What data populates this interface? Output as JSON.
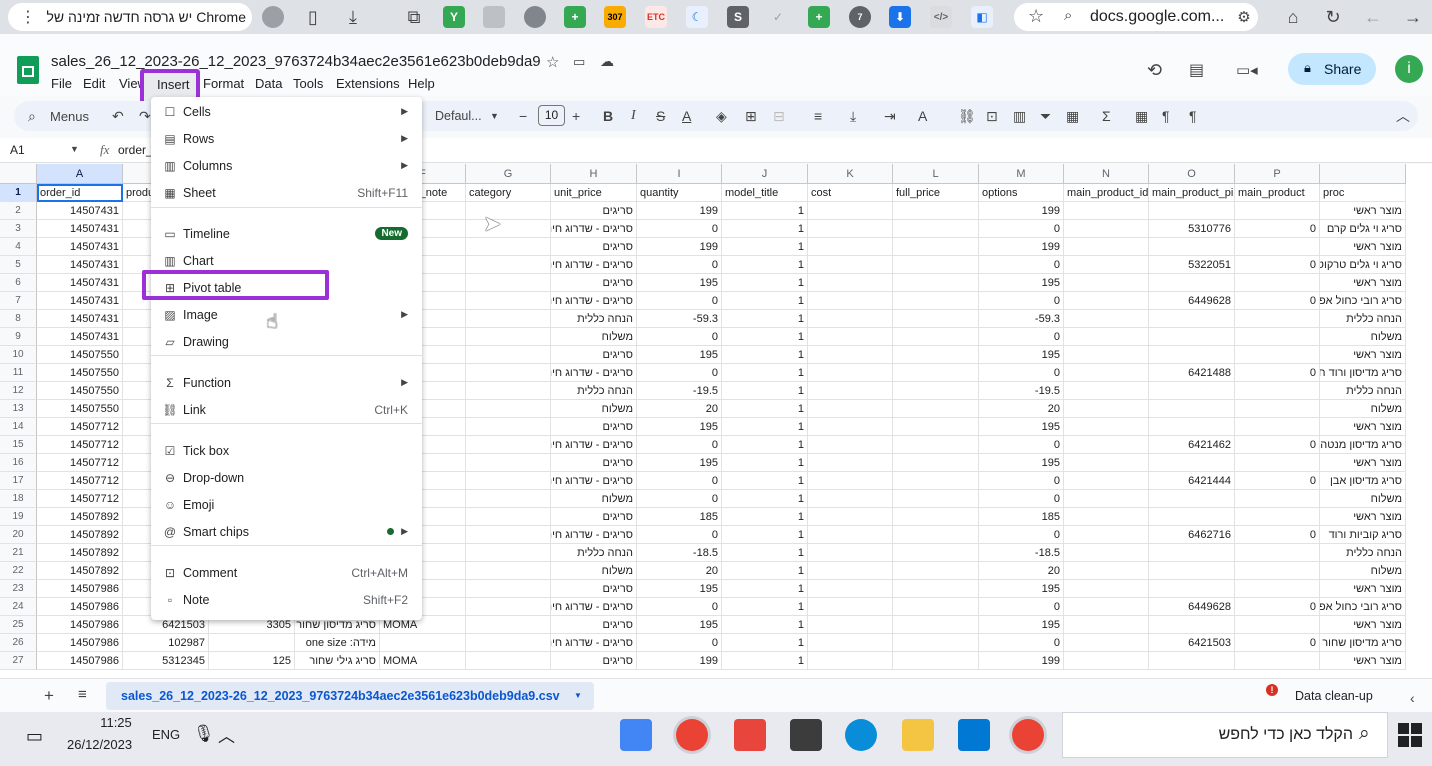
{
  "browser": {
    "menu_text": "יש גרסה חדשה זמינה של Chrome",
    "address": "docs.google.com...",
    "ext_badge_1": "307",
    "ext_badge_2": "7"
  },
  "doc": {
    "title": "sales_26_12_2023-26_12_2023_9763724b34aec2e3561e623b0deb9da9",
    "menus": [
      "File",
      "Edit",
      "View",
      "Insert",
      "Format",
      "Data",
      "Tools",
      "Extensions",
      "Help"
    ],
    "share_label": "Share",
    "avatar_letter": "i"
  },
  "toolbar": {
    "menus_label": "Menus",
    "font": "Defaul...",
    "font_size": "10"
  },
  "formula": {
    "cell_ref": "A1",
    "content": "order_i"
  },
  "grid": {
    "columns": [
      "A",
      "",
      "",
      "E",
      "F",
      "G",
      "H",
      "I",
      "J",
      "K",
      "L",
      "M",
      "N",
      "O",
      "P",
      ""
    ],
    "header_row": [
      "order_id",
      "produ",
      "",
      "itle",
      "product_note",
      "category",
      "unit_price",
      "quantity",
      "model_title",
      "cost",
      "full_price",
      "options",
      "main_product_id",
      "main_product_pi",
      "main_product",
      "proc"
    ],
    "rows": [
      {
        "n": "2",
        "a": "14507431",
        "g": "סריגים",
        "h": "199",
        "i": "1",
        "l": "199",
        "n2": "",
        "o": "",
        "p": "מוצר ראשי"
      },
      {
        "n": "3",
        "a": "14507431",
        "g": "סריגים - שדרוג חינמי",
        "h": "0",
        "i": "1",
        "l": "0",
        "n2": "5310776",
        "o": "0",
        "p": "סריג וי גלים קרם"
      },
      {
        "n": "4",
        "a": "14507431",
        "g": "סריגים",
        "h": "199",
        "i": "1",
        "l": "199",
        "n2": "",
        "o": "",
        "p": "מוצר ראשי"
      },
      {
        "n": "5",
        "a": "14507431",
        "g": "סריגים - שדרוג חינמי",
        "h": "0",
        "i": "1",
        "l": "0",
        "n2": "5322051",
        "o": "0",
        "p": "סריג וי גלים טרקוטה"
      },
      {
        "n": "6",
        "a": "14507431",
        "g": "סריגים",
        "h": "195",
        "i": "1",
        "l": "195",
        "n2": "",
        "o": "",
        "p": "מוצר ראשי"
      },
      {
        "n": "7",
        "a": "14507431",
        "g": "סריגים - שדרוג חינמי",
        "h": "0",
        "i": "1",
        "l": "0",
        "n2": "6449628",
        "o": "0",
        "p": "סריג רובי כחול אפור"
      },
      {
        "n": "8",
        "a": "14507431",
        "g": "הנחה כללית",
        "h": "-59.3",
        "i": "1",
        "l": "-59.3",
        "n2": "",
        "o": "",
        "p": "הנחה כללית"
      },
      {
        "n": "9",
        "a": "14507431",
        "g": "משלוח",
        "h": "0",
        "i": "1",
        "l": "0",
        "n2": "",
        "o": "",
        "p": "משלוח"
      },
      {
        "n": "10",
        "a": "14507550",
        "g": "סריגים",
        "h": "195",
        "i": "1",
        "l": "195",
        "n2": "",
        "o": "",
        "p": "מוצר ראשי"
      },
      {
        "n": "11",
        "a": "14507550",
        "g": "סריגים - שדרוג חינמי",
        "h": "0",
        "i": "1",
        "l": "0",
        "n2": "6421488",
        "o": "0",
        "p": "סריג מדיסון ורוד חם"
      },
      {
        "n": "12",
        "a": "14507550",
        "g": "הנחה כללית",
        "h": "-19.5",
        "i": "1",
        "l": "-19.5",
        "n2": "",
        "o": "",
        "p": "הנחה כללית"
      },
      {
        "n": "13",
        "a": "14507550",
        "g": "משלוח",
        "h": "20",
        "i": "1",
        "l": "20",
        "n2": "",
        "o": "",
        "p": "משלוח"
      },
      {
        "n": "14",
        "a": "14507712",
        "g": "סריגים",
        "h": "195",
        "i": "1",
        "l": "195",
        "n2": "",
        "o": "",
        "p": "מוצר ראשי"
      },
      {
        "n": "15",
        "a": "14507712",
        "g": "סריגים - שדרוג חינמי",
        "h": "0",
        "i": "1",
        "l": "0",
        "n2": "6421462",
        "o": "0",
        "p": "סריג מדיסון מנטה"
      },
      {
        "n": "16",
        "a": "14507712",
        "g": "סריגים",
        "h": "195",
        "i": "1",
        "l": "195",
        "n2": "",
        "o": "",
        "p": "מוצר ראשי"
      },
      {
        "n": "17",
        "a": "14507712",
        "g": "סריגים - שדרוג חינמי",
        "h": "0",
        "i": "1",
        "l": "0",
        "n2": "6421444",
        "o": "0",
        "p": "סריג מדיסון אבן"
      },
      {
        "n": "18",
        "a": "14507712",
        "g": "משלוח",
        "h": "0",
        "i": "1",
        "l": "0",
        "n2": "",
        "o": "",
        "p": "משלוח"
      },
      {
        "n": "19",
        "a": "14507892",
        "g": "סריגים",
        "h": "185",
        "i": "1",
        "l": "185",
        "n2": "",
        "o": "",
        "p": "מוצר ראשי"
      },
      {
        "n": "20",
        "a": "14507892",
        "g": "סריגים - שדרוג חינמי",
        "h": "0",
        "i": "1",
        "l": "0",
        "n2": "6462716",
        "o": "0",
        "p": "סריג קוביות ורוד"
      },
      {
        "n": "21",
        "a": "14507892",
        "g": "הנחה כללית",
        "h": "-18.5",
        "i": "1",
        "l": "-18.5",
        "n2": "",
        "o": "",
        "p": "הנחה כללית"
      },
      {
        "n": "22",
        "a": "14507892",
        "g": "משלוח",
        "h": "20",
        "i": "1",
        "l": "20",
        "n2": "",
        "o": "",
        "p": "משלוח"
      },
      {
        "n": "23",
        "a": "14507986",
        "g": "סריגים",
        "h": "195",
        "i": "1",
        "l": "195",
        "n2": "",
        "o": "",
        "p": "מוצר ראשי"
      },
      {
        "n": "24",
        "a": "14507986",
        "g": "סריגים - שדרוג חינמי",
        "h": "0",
        "i": "1",
        "l": "0",
        "n2": "6449628",
        "o": "0",
        "p": "סריג רובי כחול אפור"
      },
      {
        "n": "25",
        "a": "14507986",
        "b": "6421503",
        "c": "3305",
        "d": "סריג מדיסון שחור",
        "e": "MOMA",
        "g": "סריגים",
        "h": "195",
        "i": "1",
        "l": "195",
        "n2": "",
        "o": "",
        "p": "מוצר ראשי"
      },
      {
        "n": "26",
        "a": "14507986",
        "b": "102987",
        "c": "",
        "d": "מידה: one size",
        "e": "",
        "g": "סריגים - שדרוג חינמי",
        "h": "0",
        "i": "1",
        "l": "0",
        "n2": "6421503",
        "o": "0",
        "p": "סריג מדיסון שחור"
      },
      {
        "n": "27",
        "a": "14507986",
        "b": "5312345",
        "c": "125",
        "d": "סריג גילי שחור",
        "e": "MOMA",
        "g": "סריגים",
        "h": "199",
        "i": "1",
        "l": "199",
        "n2": "",
        "o": "",
        "p": "מוצר ראשי"
      }
    ]
  },
  "insert_menu": {
    "items": [
      {
        "label": "Cells",
        "icon": "cells-icon",
        "shortcut": "",
        "arrow": true
      },
      {
        "label": "Rows",
        "icon": "rows-icon",
        "shortcut": "",
        "arrow": true
      },
      {
        "label": "Columns",
        "icon": "columns-icon",
        "shortcut": "",
        "arrow": true
      },
      {
        "label": "Sheet",
        "icon": "sheet-icon",
        "shortcut": "Shift+F11",
        "arrow": false
      },
      {
        "label": "Timeline",
        "icon": "timeline-icon",
        "shortcut": "",
        "arrow": false,
        "badge": "New"
      },
      {
        "label": "Chart",
        "icon": "chart-icon",
        "shortcut": "",
        "arrow": false
      },
      {
        "label": "Pivot table",
        "icon": "pivot-table-icon",
        "shortcut": "",
        "arrow": false
      },
      {
        "label": "Image",
        "icon": "image-icon",
        "shortcut": "",
        "arrow": true
      },
      {
        "label": "Drawing",
        "icon": "drawing-icon",
        "shortcut": "",
        "arrow": false
      },
      {
        "label": "Function",
        "icon": "function-icon",
        "shortcut": "",
        "arrow": true
      },
      {
        "label": "Link",
        "icon": "link-icon",
        "shortcut": "Ctrl+K",
        "arrow": false
      },
      {
        "label": "Tick box",
        "icon": "tick-box-icon",
        "shortcut": "",
        "arrow": false
      },
      {
        "label": "Drop-down",
        "icon": "dropdown-icon",
        "shortcut": "",
        "arrow": false
      },
      {
        "label": "Emoji",
        "icon": "emoji-icon",
        "shortcut": "",
        "arrow": false
      },
      {
        "label": "Smart chips",
        "icon": "smart-chips-icon",
        "shortcut": "",
        "arrow": true
      },
      {
        "label": "Comment",
        "icon": "comment-icon",
        "shortcut": "Ctrl+Alt+M",
        "arrow": false
      },
      {
        "label": "Note",
        "icon": "note-icon",
        "shortcut": "Shift+F2",
        "arrow": false
      }
    ]
  },
  "sheetbar": {
    "tab_label": "sales_26_12_2023-26_12_2023_9763724b34aec2e3561e623b0deb9da9.csv",
    "cleanup_label": "Data clean-up"
  },
  "taskbar": {
    "time": "11:25",
    "date": "26/12/2023",
    "lang": "ENG",
    "search_placeholder": "הקלד כאן כדי לחפש"
  },
  "colors": {
    "highlight": "#9b30d9",
    "sheets_green": "#0f9d58",
    "share_bg": "#c2e7ff",
    "tab_blue": "#0b57d0"
  }
}
